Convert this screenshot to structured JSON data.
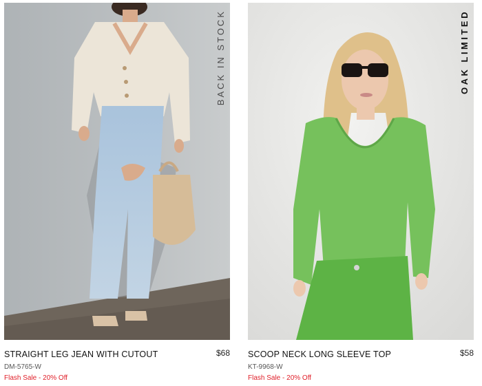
{
  "products": [
    {
      "badge": "BACK IN STOCK",
      "title": "STRAIGHT LEG JEAN WITH CUTOUT",
      "price": "$68",
      "sku": "DM-5765-W",
      "promo": "Flash Sale - 20% Off"
    },
    {
      "badge": "OAK LIMITED",
      "title": "SCOOP NECK LONG SLEEVE TOP",
      "price": "$58",
      "sku": "KT-9968-W",
      "promo": "Flash Sale - 20% Off"
    }
  ],
  "colors": {
    "sale": "#e0202a",
    "photo1_bg": "#b7bcbf",
    "photo2_bg": "#e6e6e4"
  }
}
